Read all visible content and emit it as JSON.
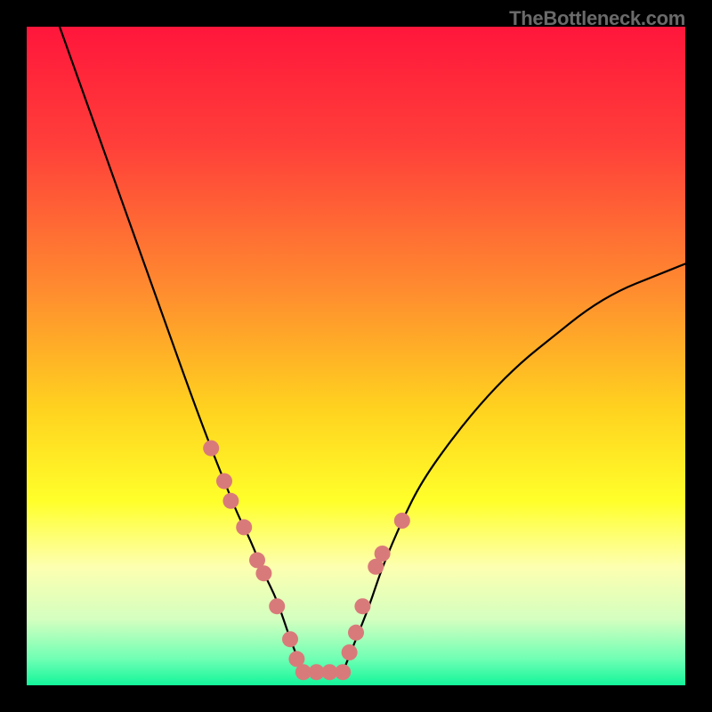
{
  "watermark": "TheBottleneck.com",
  "chart_data": {
    "type": "line",
    "title": "",
    "xlabel": "",
    "ylabel": "",
    "xlim": [
      0,
      100
    ],
    "ylim": [
      0,
      100
    ],
    "series": [
      {
        "name": "left-curve",
        "x": [
          5,
          10,
          15,
          20,
          25,
          28,
          30,
          32,
          34,
          36,
          38,
          40,
          42
        ],
        "values": [
          100,
          86,
          72,
          58,
          44,
          36,
          31,
          26,
          22,
          17,
          13,
          7,
          2
        ]
      },
      {
        "name": "right-curve",
        "x": [
          48,
          50,
          52,
          54,
          57,
          60,
          65,
          70,
          75,
          80,
          85,
          90,
          95,
          100
        ],
        "values": [
          2,
          7,
          12,
          18,
          25,
          31,
          38,
          44,
          49,
          53,
          57,
          60,
          62,
          64
        ]
      }
    ],
    "markers": {
      "name": "highlighted-points",
      "color": "#d97a7a",
      "x": [
        28,
        30,
        31,
        33,
        35,
        36,
        38,
        40,
        41,
        42,
        44,
        46,
        48,
        49,
        50,
        51,
        53,
        54,
        57
      ],
      "values": [
        36,
        31,
        28,
        24,
        19,
        17,
        12,
        7,
        4,
        2,
        2,
        2,
        2,
        5,
        8,
        12,
        18,
        20,
        25
      ]
    },
    "gradient_stops": [
      {
        "offset": 0.0,
        "color": "#ff163b"
      },
      {
        "offset": 0.18,
        "color": "#ff3f3a"
      },
      {
        "offset": 0.4,
        "color": "#ff8c2f"
      },
      {
        "offset": 0.58,
        "color": "#ffd21f"
      },
      {
        "offset": 0.72,
        "color": "#ffff2a"
      },
      {
        "offset": 0.82,
        "color": "#fdffb0"
      },
      {
        "offset": 0.9,
        "color": "#d4ffc0"
      },
      {
        "offset": 0.96,
        "color": "#6fffb4"
      },
      {
        "offset": 1.0,
        "color": "#13f59a"
      }
    ]
  }
}
